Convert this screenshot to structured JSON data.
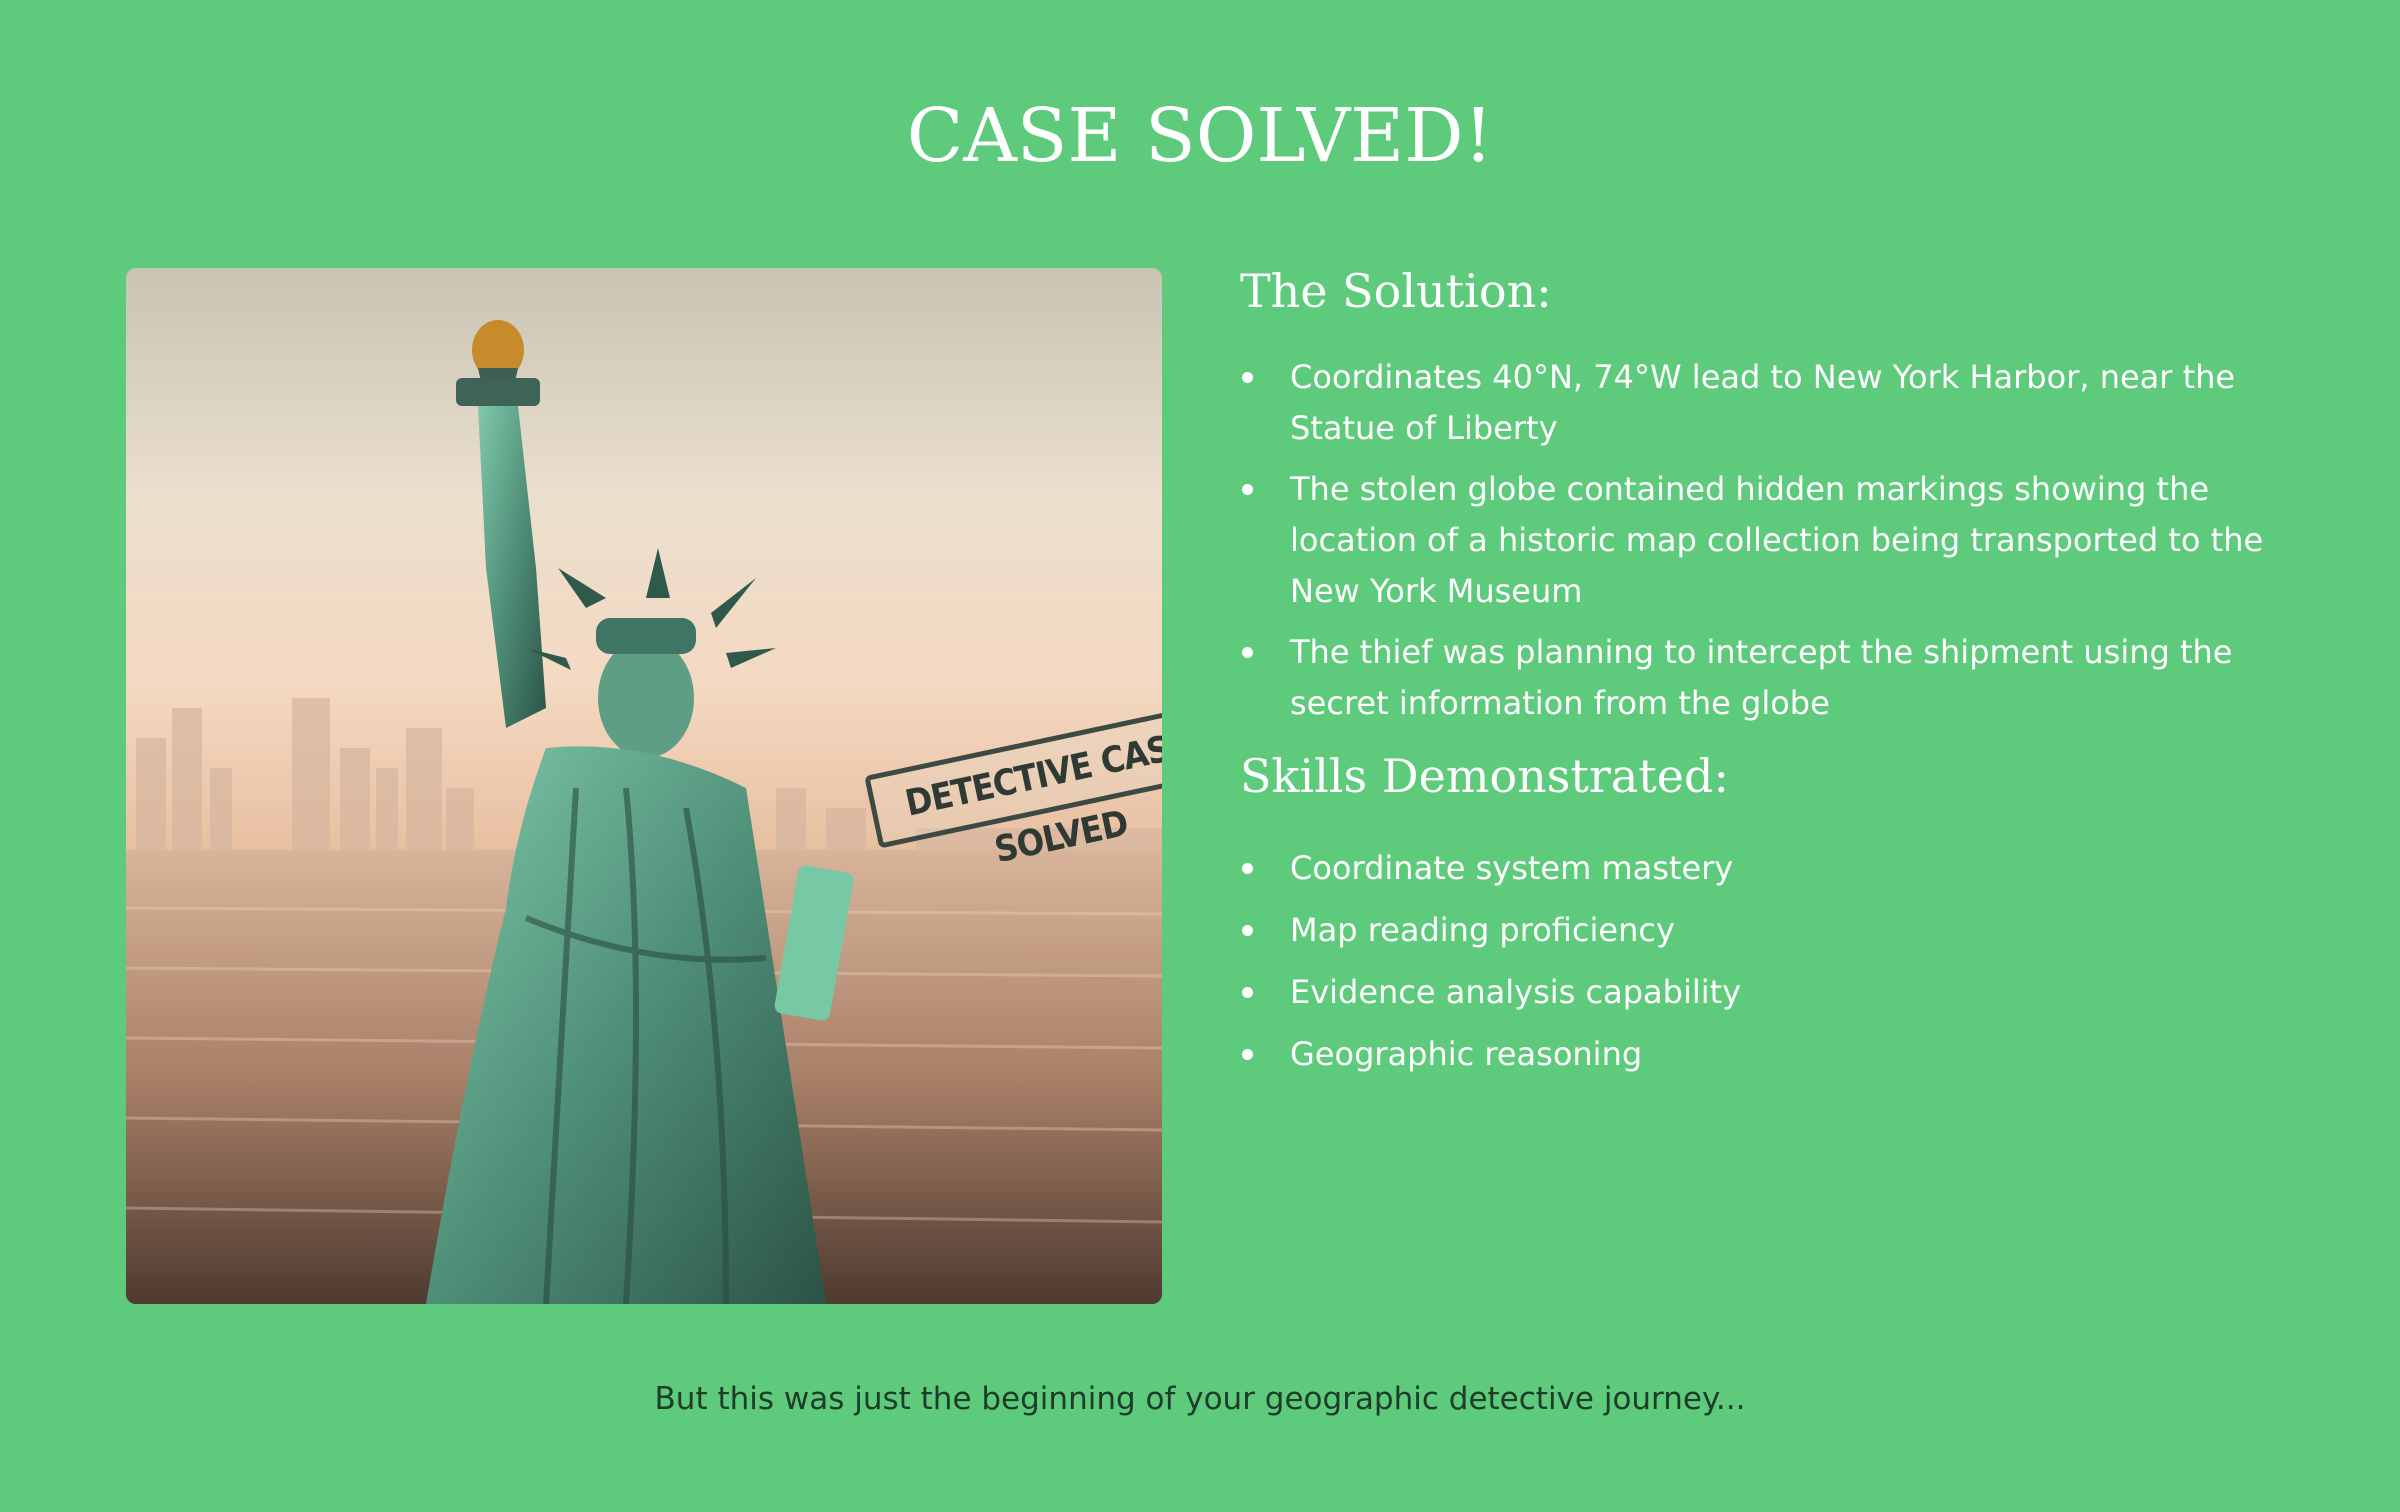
{
  "page": {
    "title": "CASE SOLVED!",
    "footer": "But this was just the beginning of your geographic detective journey..."
  },
  "image": {
    "description_icon": "statue-of-liberty-image",
    "stamp_text": "DETECTIVE CASE SOLVED"
  },
  "solution": {
    "heading": "The Solution:",
    "items": [
      "Coordinates 40°N, 74°W lead to New York Harbor, near the Statue of Liberty",
      "The stolen globe contained hidden markings showing the location of a historic map collection being transported to the New York Museum",
      "The thief was planning to intercept the shipment using the secret information from the globe"
    ]
  },
  "skills": {
    "heading": "Skills Demonstrated:",
    "items": [
      "Coordinate system mastery",
      "Map reading proficiency",
      "Evidence analysis capability",
      "Geographic reasoning"
    ]
  },
  "colors": {
    "background": "#5ecb7c",
    "text": "#ffffff",
    "footer_text": "#1f3b2a"
  }
}
